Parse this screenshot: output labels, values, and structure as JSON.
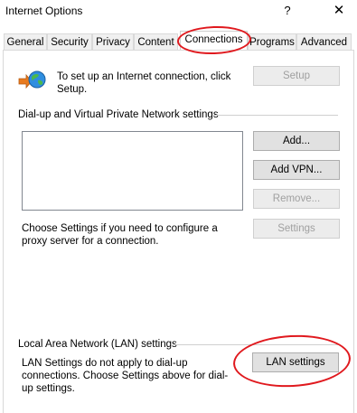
{
  "window": {
    "title": "Internet Options",
    "help_label": "?",
    "close_label": "✕"
  },
  "tabs": [
    {
      "label": "General",
      "active": false
    },
    {
      "label": "Security",
      "active": false
    },
    {
      "label": "Privacy",
      "active": false
    },
    {
      "label": "Content",
      "active": false
    },
    {
      "label": "Connections",
      "active": true
    },
    {
      "label": "Programs",
      "active": false
    },
    {
      "label": "Advanced",
      "active": false
    }
  ],
  "connections": {
    "setup_text": "To set up an Internet connection, click Setup.",
    "setup_button": "Setup",
    "dialup_group_label": "Dial-up and Virtual Private Network settings",
    "add_button": "Add...",
    "add_vpn_button": "Add VPN...",
    "remove_button": "Remove...",
    "proxy_text": "Choose Settings if you need to configure a proxy server for a connection.",
    "settings_button": "Settings",
    "lan_group_label": "Local Area Network (LAN) settings",
    "lan_text": "LAN Settings do not apply to dial-up connections. Choose Settings above for dial-up settings.",
    "lan_settings_button": "LAN settings"
  },
  "annotation_color": "#e0191e",
  "icons": {
    "internet": "globe-arrow-icon"
  }
}
